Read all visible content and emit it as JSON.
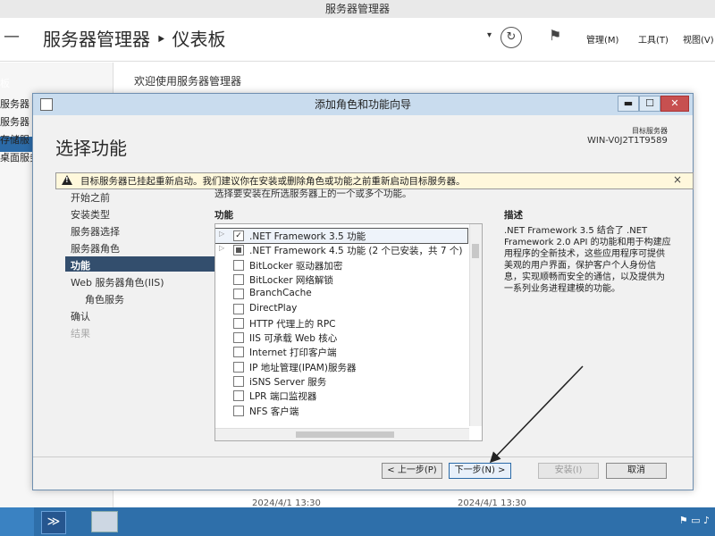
{
  "app": {
    "window_title": "服务器管理器",
    "breadcrumb": "服务器管理器 ‣ 仪表板",
    "menu": {
      "manage": "管理(M)",
      "tools": "工具(T)",
      "view": "视图(V)"
    },
    "sidebar": [
      "板",
      "服务器",
      "服务器",
      "存储服",
      "桌面服务"
    ],
    "welcome": "欢迎使用服务器管理器",
    "bg_dates": [
      "2024/4/1 13:30",
      "2024/4/1 13:30"
    ]
  },
  "dialog": {
    "title": "添加角色和功能向导",
    "heading": "选择功能",
    "target_server_label": "目标服务器",
    "target_server_name": "WIN-V0J2T1T9589",
    "warning": "目标服务器已挂起重新启动。我们建议你在安装或删除角色或功能之前重新启动目标服务器。",
    "warning_close": "×",
    "subtitle": "选择要安装在所选服务器上的一个或多个功能。",
    "features_label": "功能",
    "description_label": "描述",
    "description_text": ".NET Framework 3.5 结合了 .NET Framework 2.0 API 的功能和用于构建应用程序的全新技术，这些应用程序可提供美观的用户界面，保护客户个人身份信息，实现顺畅而安全的通信，以及提供为一系列业务进程建模的功能。",
    "nav": [
      {
        "label": "开始之前",
        "active": false,
        "indent": false,
        "disabled": false
      },
      {
        "label": "安装类型",
        "active": false,
        "indent": false,
        "disabled": false
      },
      {
        "label": "服务器选择",
        "active": false,
        "indent": false,
        "disabled": false
      },
      {
        "label": "服务器角色",
        "active": false,
        "indent": false,
        "disabled": false
      },
      {
        "label": "功能",
        "active": true,
        "indent": false,
        "disabled": false
      },
      {
        "label": "Web 服务器角色(IIS)",
        "active": false,
        "indent": false,
        "disabled": false
      },
      {
        "label": "角色服务",
        "active": false,
        "indent": true,
        "disabled": false
      },
      {
        "label": "确认",
        "active": false,
        "indent": false,
        "disabled": false
      },
      {
        "label": "结果",
        "active": false,
        "indent": false,
        "disabled": true
      }
    ],
    "features": [
      {
        "label": ".NET Framework 3.5 功能",
        "state": "checked",
        "expandable": true
      },
      {
        "label": ".NET Framework 4.5 功能 (2 个已安装，共 7 个)",
        "state": "partial",
        "expandable": true
      },
      {
        "label": "BitLocker 驱动器加密",
        "state": "unchecked",
        "expandable": false
      },
      {
        "label": "BitLocker 网络解锁",
        "state": "unchecked",
        "expandable": false
      },
      {
        "label": "BranchCache",
        "state": "unchecked",
        "expandable": false
      },
      {
        "label": "DirectPlay",
        "state": "unchecked",
        "expandable": false
      },
      {
        "label": "HTTP 代理上的 RPC",
        "state": "unchecked",
        "expandable": false
      },
      {
        "label": "IIS 可承载 Web 核心",
        "state": "unchecked",
        "expandable": false
      },
      {
        "label": "Internet 打印客户端",
        "state": "unchecked",
        "expandable": false
      },
      {
        "label": "IP 地址管理(IPAM)服务器",
        "state": "unchecked",
        "expandable": false
      },
      {
        "label": "iSNS Server 服务",
        "state": "unchecked",
        "expandable": false
      },
      {
        "label": "LPR 端口监视器",
        "state": "unchecked",
        "expandable": false
      },
      {
        "label": "NFS 客户端",
        "state": "unchecked",
        "expandable": false
      }
    ],
    "buttons": {
      "prev": "< 上一步(P)",
      "next": "下一步(N) >",
      "install": "安装(I)",
      "cancel": "取消"
    },
    "window_buttons": {
      "minimize": "▬",
      "maximize": "☐",
      "close": "✕"
    }
  },
  "colors": {
    "accent": "#2b6aa7",
    "nav_active": "#334e6d",
    "taskbar": "#2e6faa"
  }
}
